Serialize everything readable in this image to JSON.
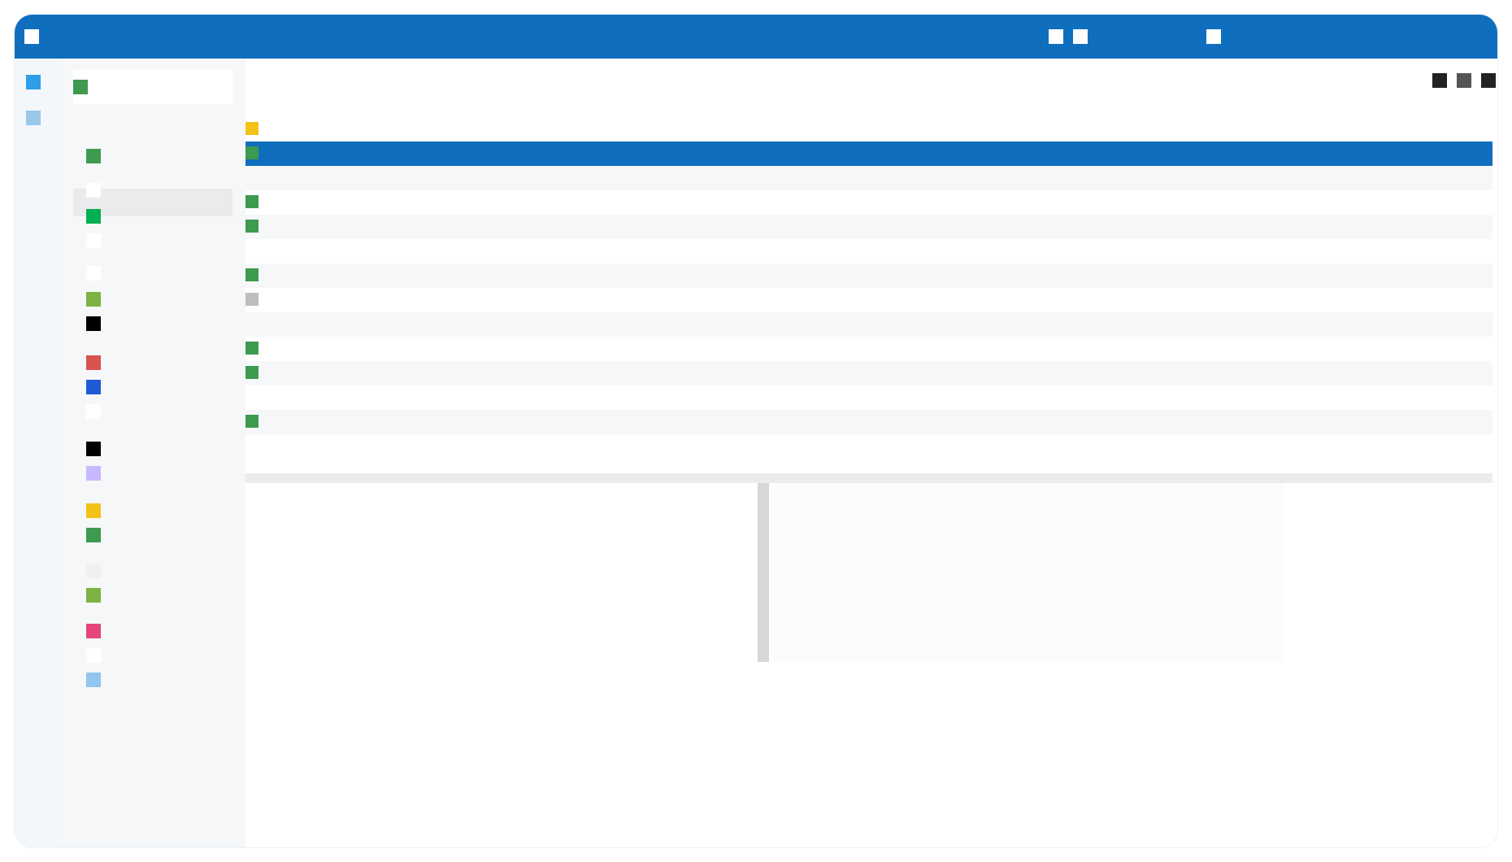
{
  "window": {
    "title": "",
    "colors": {
      "accent": "#106ebe",
      "green": "#3d9a4f",
      "green_alt": "#00b050",
      "yellow": "#f2c216",
      "red": "#d9534f",
      "blue": "#1f5bd6",
      "purple": "#c8b8ff",
      "pink": "#e6457a",
      "lightblue": "#90c6f0"
    }
  },
  "titlebar": {
    "left_icon": "window-icon",
    "right_icons": [
      "minimize-icon",
      "maximize-icon",
      "close-icon"
    ]
  },
  "rail": {
    "items": [
      {
        "icon": "blue-app-icon",
        "color": "#2e9ee8"
      },
      {
        "icon": "pale-app-icon",
        "color": "#9bc7ea"
      }
    ]
  },
  "sidebar": {
    "header": {
      "label": "",
      "icon": "green-square-icon"
    },
    "items": [
      {
        "icon": "green-square-icon",
        "color": "#3d9a4f",
        "label": ""
      },
      {
        "icon": "blank-icon",
        "color": "#ffffff",
        "label": ""
      },
      {
        "icon": "green-square-icon",
        "color": "#00b050",
        "label": ""
      },
      {
        "icon": "blank-icon",
        "color": "#ffffff",
        "label": ""
      },
      {
        "icon": "blank-icon",
        "color": "#ffffff",
        "label": ""
      },
      {
        "icon": "lime-square-icon",
        "color": "#7cb342",
        "label": ""
      },
      {
        "icon": "black-square-icon",
        "color": "#000000",
        "label": ""
      },
      {
        "icon": "red-square-icon",
        "color": "#d9534f",
        "label": ""
      },
      {
        "icon": "blue-square-icon",
        "color": "#1f5bd6",
        "label": ""
      },
      {
        "icon": "blank-icon",
        "color": "#ffffff",
        "label": ""
      },
      {
        "icon": "black-square-icon",
        "color": "#000000",
        "label": ""
      },
      {
        "icon": "purple-square-icon",
        "color": "#c8b8ff",
        "label": ""
      },
      {
        "icon": "yellow-square-icon",
        "color": "#f2c216",
        "label": ""
      },
      {
        "icon": "green-square-icon",
        "color": "#3d9a4f",
        "label": ""
      },
      {
        "icon": "blank-icon",
        "color": "#f0f0f0",
        "label": ""
      },
      {
        "icon": "lime-square-icon",
        "color": "#7cb342",
        "label": ""
      },
      {
        "icon": "pink-square-icon",
        "color": "#e6457a",
        "label": ""
      },
      {
        "icon": "blank-icon",
        "color": "#ffffff",
        "label": ""
      },
      {
        "icon": "lightblue-square-icon",
        "color": "#90c6f0",
        "label": ""
      }
    ]
  },
  "toolbar": {
    "icons": [
      "refresh-icon",
      "filter-icon",
      "more-icon"
    ]
  },
  "table": {
    "columns": [
      "",
      "",
      "",
      "",
      "",
      "",
      ""
    ],
    "rows": [
      {
        "status": "yellow",
        "c1": "",
        "c2": "",
        "c3": "",
        "c4": "",
        "c5": "",
        "c6": ""
      },
      {
        "status": "green",
        "c1": "",
        "c2": "",
        "c3": "",
        "c4": "",
        "c5": "",
        "c6": "",
        "selected": true
      },
      {
        "status": "",
        "c1": "",
        "c2": "",
        "c3": "",
        "c4": "",
        "c5": "",
        "c6": ""
      },
      {
        "status": "green",
        "c1": "",
        "c2": "",
        "c3": "",
        "c4": "",
        "c5": "",
        "c6": ""
      },
      {
        "status": "green",
        "c1": "",
        "c2": "",
        "c3": "",
        "c4": "",
        "c5": "",
        "c6": ""
      },
      {
        "status": "",
        "c1": "",
        "c2": "",
        "c3": "",
        "c4": "",
        "c5": "",
        "c6": ""
      },
      {
        "status": "green",
        "c1": "",
        "c2": "",
        "c3": "",
        "c4": "",
        "c5": "",
        "c6": ""
      },
      {
        "status": "gray",
        "c1": "",
        "c2": "",
        "c3": "",
        "c4": "",
        "c5": "",
        "c6": ""
      },
      {
        "status": "",
        "c1": "",
        "c2": "",
        "c3": "",
        "c4": "",
        "c5": "",
        "c6": ""
      },
      {
        "status": "green",
        "c1": "",
        "c2": "",
        "c3": "",
        "c4": "",
        "c5": "",
        "c6": ""
      },
      {
        "status": "green",
        "c1": "",
        "c2": "",
        "c3": "",
        "c4": "",
        "c5": "",
        "c6": ""
      },
      {
        "status": "",
        "c1": "",
        "c2": "",
        "c3": "",
        "c4": "",
        "c5": "",
        "c6": ""
      },
      {
        "status": "green",
        "c1": "",
        "c2": "",
        "c3": "",
        "c4": "",
        "c5": "",
        "c6": ""
      }
    ]
  },
  "lower": {
    "left_title": "",
    "right_title": ""
  }
}
